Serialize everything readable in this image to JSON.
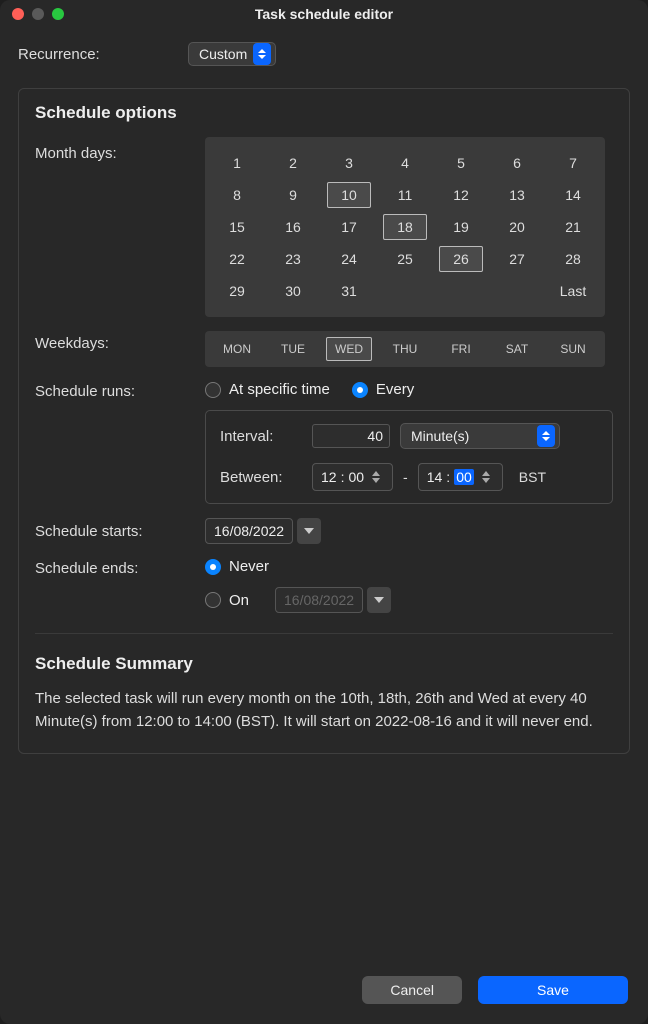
{
  "window": {
    "title": "Task schedule editor"
  },
  "recurrence": {
    "label": "Recurrence:",
    "value": "Custom"
  },
  "schedule_options": {
    "heading": "Schedule options",
    "month_days_label": "Month days:",
    "days": [
      "1",
      "2",
      "3",
      "4",
      "5",
      "6",
      "7",
      "8",
      "9",
      "10",
      "11",
      "12",
      "13",
      "14",
      "15",
      "16",
      "17",
      "18",
      "19",
      "20",
      "21",
      "22",
      "23",
      "24",
      "25",
      "26",
      "27",
      "28",
      "29",
      "30",
      "31"
    ],
    "last_label": "Last",
    "selected_days": [
      "10",
      "18",
      "26"
    ],
    "weekdays_label": "Weekdays:",
    "weekdays": [
      "MON",
      "TUE",
      "WED",
      "THU",
      "FRI",
      "SAT",
      "SUN"
    ],
    "selected_weekdays": [
      "WED"
    ],
    "schedule_runs_label": "Schedule runs:",
    "run_mode": {
      "specific_label": "At specific time",
      "every_label": "Every",
      "selected": "every"
    },
    "interval": {
      "label": "Interval:",
      "value": "40",
      "unit": "Minute(s)"
    },
    "between": {
      "label": "Between:",
      "from_h": "12",
      "from_m": "00",
      "to_h": "14",
      "to_m": "00",
      "tz": "BST",
      "dash": "-"
    },
    "schedule_starts": {
      "label": "Schedule starts:",
      "value": "16/08/2022"
    },
    "schedule_ends": {
      "label": "Schedule ends:",
      "never_label": "Never",
      "on_label": "On",
      "on_date": "16/08/2022",
      "selected": "never"
    }
  },
  "summary": {
    "heading": "Schedule Summary",
    "text": "The selected task will run every month on the 10th, 18th, 26th and Wed at every 40 Minute(s) from 12:00 to 14:00 (BST). It will start on 2022-08-16 and it will never end."
  },
  "footer": {
    "cancel": "Cancel",
    "save": "Save"
  }
}
